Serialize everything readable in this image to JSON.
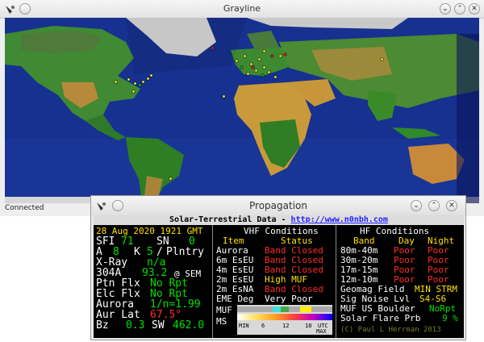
{
  "grayline": {
    "title": "Grayline",
    "status": "Connected"
  },
  "propagation": {
    "title": "Propagation",
    "header": {
      "text": "Solar-Terrestrial Data - ",
      "url": "http://www.n0nbh.com"
    },
    "date": "28 Aug 2020 1921 GMT",
    "solar": {
      "sfi_label": "SFI",
      "sfi": "71",
      "sn_label": "SN",
      "sn": "0",
      "a_label": "A",
      "a": "8",
      "k_label": "K",
      "k": "5",
      "k_sep": "/",
      "k_note": "Plntry",
      "xray_label": "X-Ray",
      "xray": "n/a",
      "304a_label": "304A",
      "304a": "93.2",
      "304a_src": "@ SEM",
      "ptn_label": "Ptn Flx",
      "ptn": "No Rpt",
      "elc_label": "Elc Flx",
      "elc": "No Rpt",
      "aurora_label": "Aurora",
      "aurora": "1/n=1.99",
      "aurlat_label": "Aur Lat",
      "aurlat": "67.5°",
      "bz_label": "Bz",
      "bz": "0.3",
      "sw_label": "SW",
      "sw": "462.0"
    },
    "vhf": {
      "title": "VHF Conditions",
      "col_item": "Item",
      "col_status": "Status",
      "rows": [
        {
          "item": "Aurora",
          "status": "Band Closed"
        },
        {
          "item": "6m EsEU",
          "status": "Band Closed"
        },
        {
          "item": "4m EsEU",
          "status": "Band Closed"
        },
        {
          "item": "2m EsEU",
          "status": "High MUF"
        },
        {
          "item": "2m EsNA",
          "status": "Band Closed"
        }
      ],
      "eme_label": "EME Deg",
      "eme": "Very Poor",
      "muf_label": "MUF",
      "ms_label": "MS",
      "scale_ticks": [
        "MIN",
        "6",
        "12",
        "18",
        "UTC"
      ],
      "scale_max": "MAX"
    },
    "hf": {
      "title": "HF Conditions",
      "col_band": "Band",
      "col_day": "Day",
      "col_night": "Night",
      "rows": [
        {
          "band": "80m-40m",
          "day": "Poor",
          "night": "Poor"
        },
        {
          "band": "30m-20m",
          "day": "Poor",
          "night": "Poor"
        },
        {
          "band": "17m-15m",
          "day": "Poor",
          "night": "Poor"
        },
        {
          "band": "12m-10m",
          "day": "Poor",
          "night": "Poor"
        }
      ],
      "geomag_label": "Geomag Field",
      "geomag": "MIN STRM",
      "signoise_label": "Sig Noise Lvl",
      "signoise": "S4-S6",
      "muf_label": "MUF US Boulder",
      "muf": "NoRpt",
      "flare_label": "Solar Flare Prb",
      "flare": "9 %",
      "copyright": "(C) Paul L Herrman 2013"
    }
  }
}
